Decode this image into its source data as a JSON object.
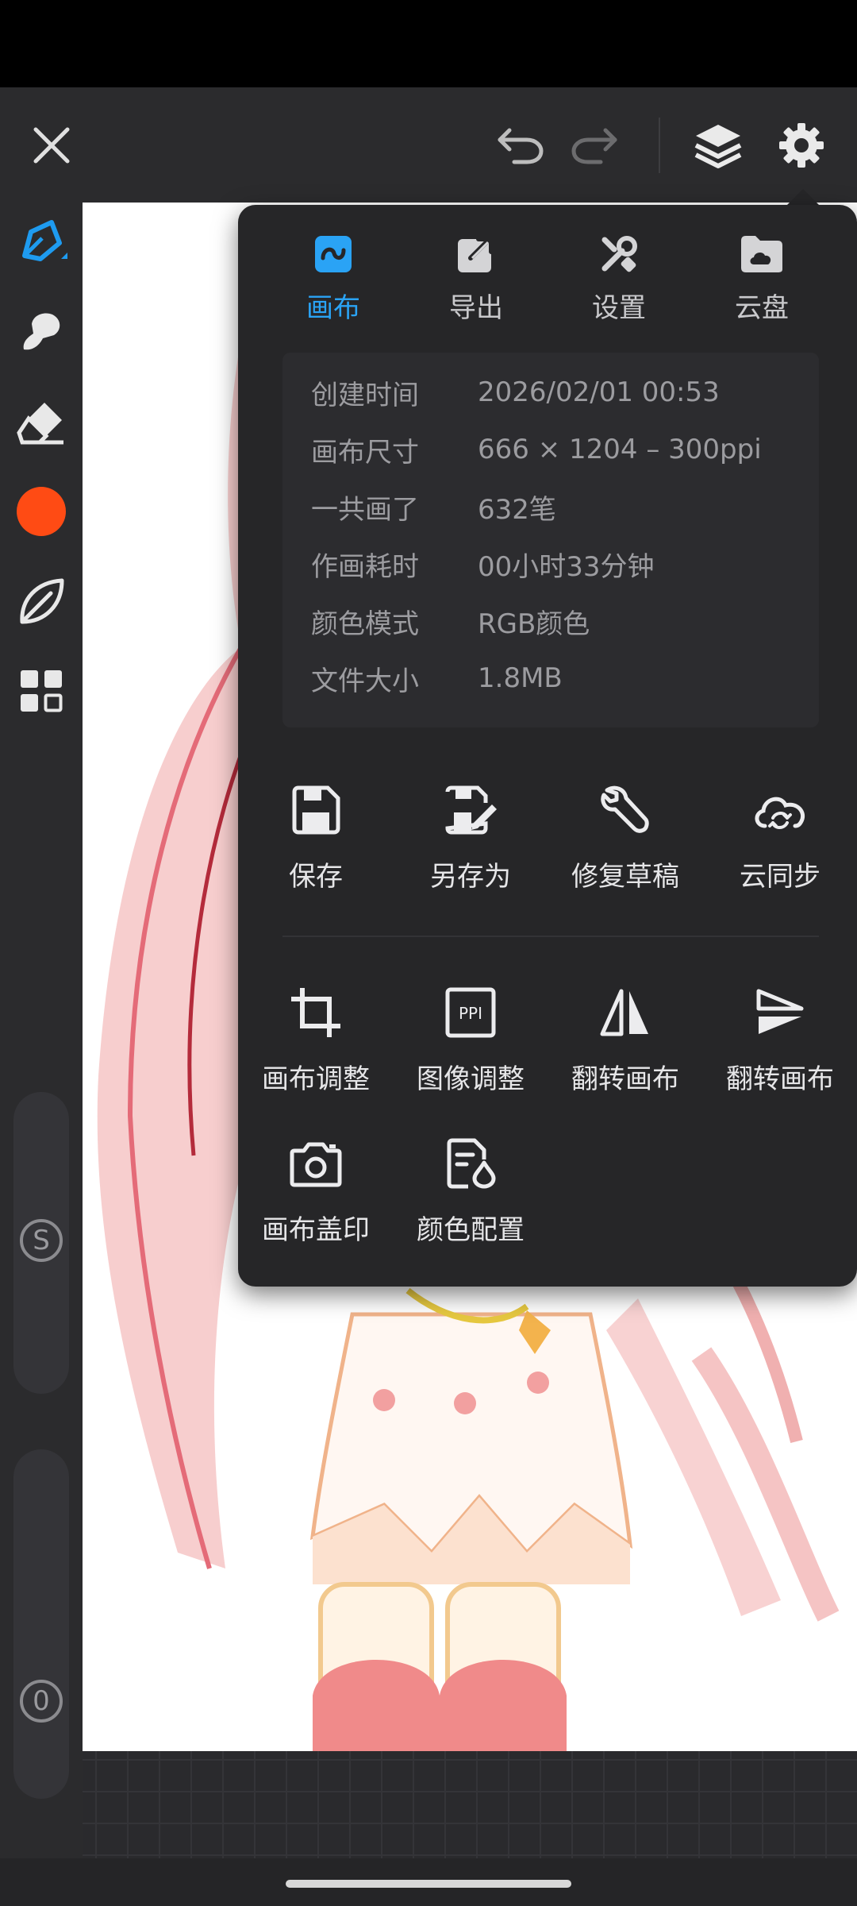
{
  "toolbar": {
    "close_icon": "close-icon",
    "undo_icon": "undo-icon",
    "redo_icon": "redo-icon",
    "layers_icon": "layers-icon",
    "settings_icon": "gear-icon"
  },
  "sidebar": {
    "tools": [
      "pen-icon",
      "smudge-icon",
      "eraser-icon",
      "color-swatch",
      "leaf-icon",
      "grid-icon"
    ],
    "brush_color": "#ff4b14",
    "size_slider_label": "S",
    "opacity_slider_label": "0"
  },
  "panel": {
    "tabs": [
      {
        "label": "画布",
        "icon": "canvas-icon",
        "active": true
      },
      {
        "label": "导出",
        "icon": "export-icon",
        "active": false
      },
      {
        "label": "设置",
        "icon": "tools-icon",
        "active": false
      },
      {
        "label": "云盘",
        "icon": "cloud-folder-icon",
        "active": false
      }
    ],
    "info": [
      {
        "key": "创建时间",
        "value": "2026/02/01 00:53"
      },
      {
        "key": "画布尺寸",
        "value": "666 × 1204 – 300ppi"
      },
      {
        "key": "一共画了",
        "value": "632笔"
      },
      {
        "key": "作画耗时",
        "value": "00小时33分钟"
      },
      {
        "key": "颜色模式",
        "value": "RGB颜色"
      },
      {
        "key": "文件大小",
        "value": "1.8MB"
      }
    ],
    "actions_row1": [
      {
        "label": "保存",
        "icon": "save-icon"
      },
      {
        "label": "另存为",
        "icon": "save-as-icon"
      },
      {
        "label": "修复草稿",
        "icon": "wrench-icon"
      },
      {
        "label": "云同步",
        "icon": "cloud-sync-icon"
      }
    ],
    "actions_row2": [
      {
        "label": "画布调整",
        "icon": "crop-icon"
      },
      {
        "label": "图像调整",
        "icon": "ppi-icon",
        "badge": "PPI"
      },
      {
        "label": "翻转画布",
        "icon": "flip-horizontal-icon"
      },
      {
        "label": "翻转画布",
        "icon": "flip-vertical-icon"
      }
    ],
    "actions_row3": [
      {
        "label": "画布盖印",
        "icon": "camera-icon"
      },
      {
        "label": "颜色配置",
        "icon": "color-profile-icon"
      }
    ],
    "accent": "#2aa3f5"
  }
}
